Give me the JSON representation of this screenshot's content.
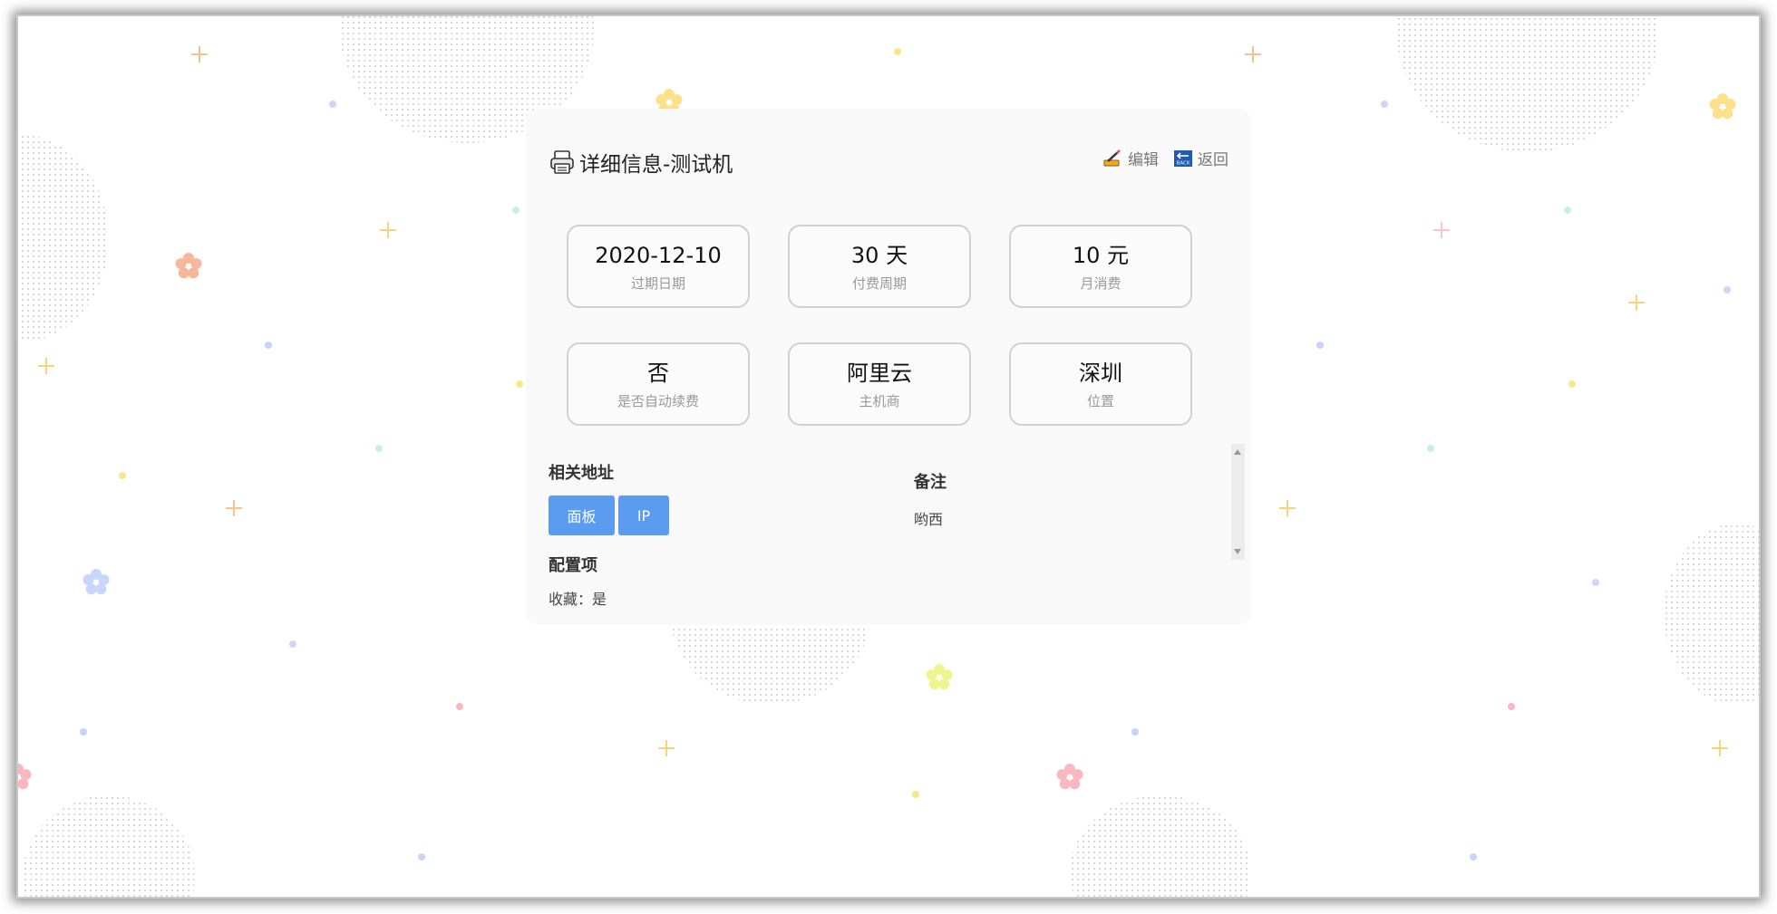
{
  "page": {
    "title": "详细信息-测试机",
    "actions": {
      "edit_label": "编辑",
      "back_label": "返回",
      "back_icon_text": "BACK"
    }
  },
  "stats": [
    {
      "value": "2020-12-10",
      "label": "过期日期"
    },
    {
      "value": "30 天",
      "label": "付费周期"
    },
    {
      "value": "10 元",
      "label": "月消费"
    },
    {
      "value": "否",
      "label": "是否自动续费"
    },
    {
      "value": "阿里云",
      "label": "主机商"
    },
    {
      "value": "深圳",
      "label": "位置"
    }
  ],
  "links": {
    "title": "相关地址",
    "buttons": [
      {
        "label": "面板"
      },
      {
        "label": "IP"
      }
    ]
  },
  "config": {
    "title": "配置项",
    "items": [
      "收藏：是"
    ]
  },
  "notes": {
    "title": "备注",
    "text": "哟西"
  },
  "colors": {
    "accent": "#5b9cf0",
    "card_bg": "#f9f9f9",
    "border": "#d0d0d0"
  }
}
